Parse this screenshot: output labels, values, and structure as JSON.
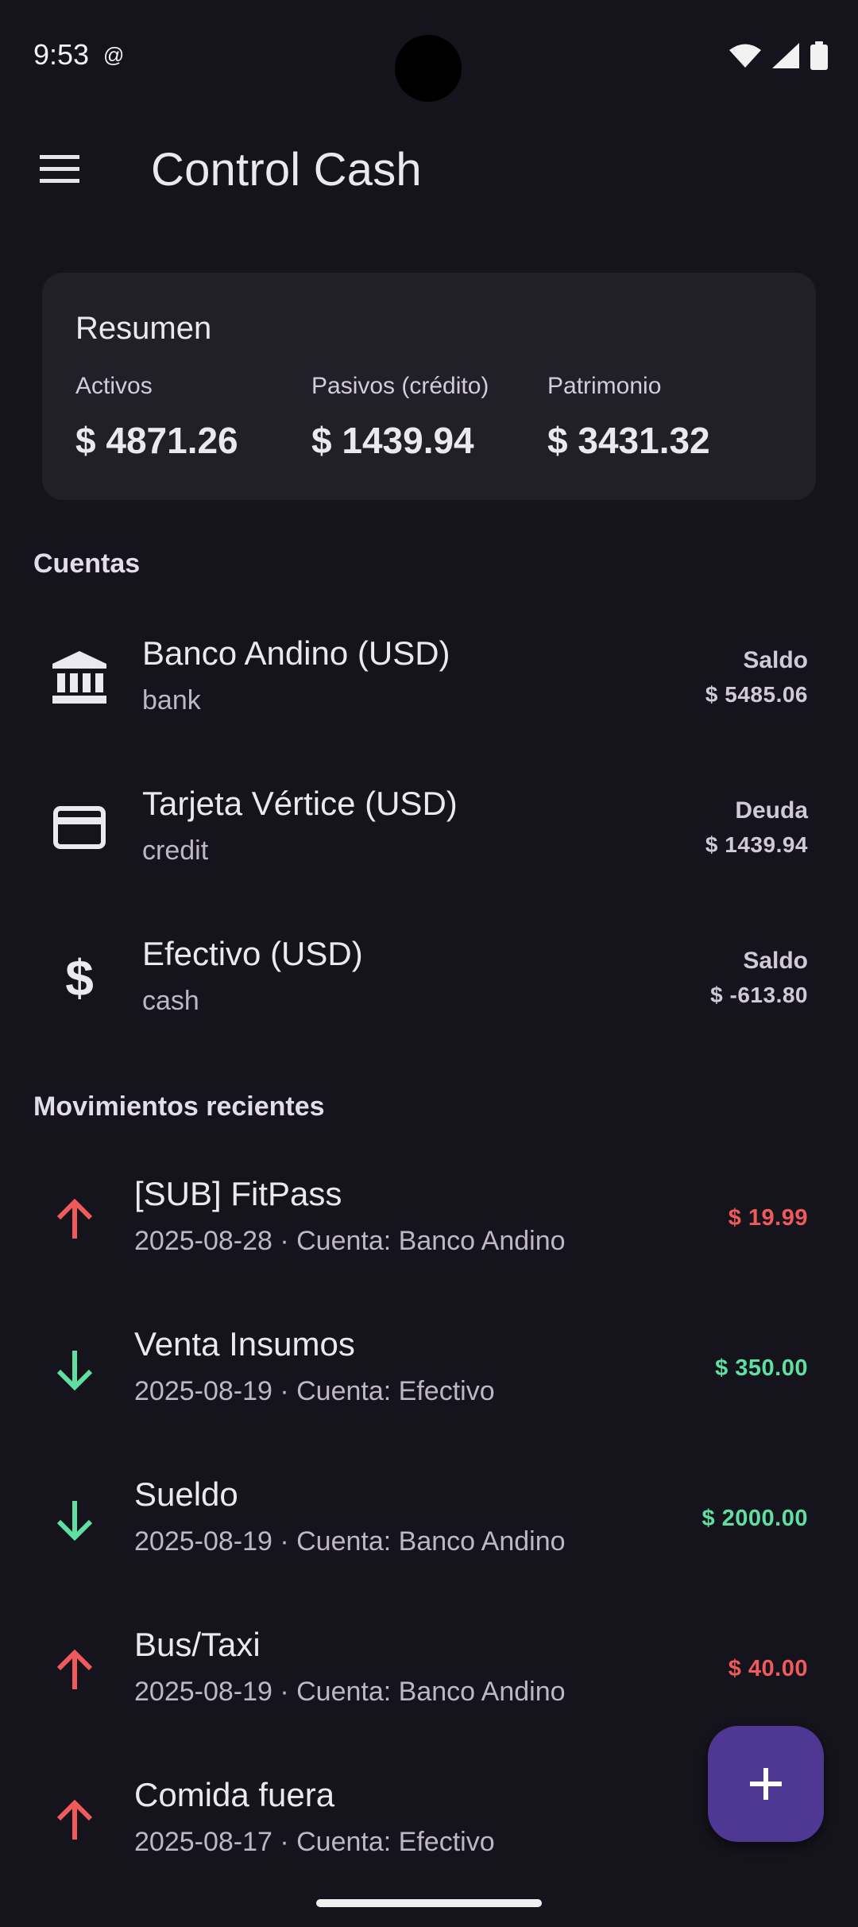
{
  "status_bar": {
    "time": "9:53",
    "notification_glyph": "@"
  },
  "app_bar": {
    "title": "Control Cash",
    "menu_icon": "menu-icon"
  },
  "summary": {
    "title": "Resumen",
    "items": [
      {
        "label": "Activos",
        "value": "$ 4871.26"
      },
      {
        "label": "Pasivos (crédito)",
        "value": "$ 1439.94"
      },
      {
        "label": "Patrimonio",
        "value": "$ 3431.32"
      }
    ]
  },
  "accounts": {
    "header": "Cuentas",
    "items": [
      {
        "name": "Banco Andino (USD)",
        "type": "bank",
        "kind": "Saldo",
        "balance": "$ 5485.06",
        "icon": "bank-icon"
      },
      {
        "name": "Tarjeta Vértice (USD)",
        "type": "credit",
        "kind": "Deuda",
        "balance": "$ 1439.94",
        "icon": "credit-card-icon"
      },
      {
        "name": "Efectivo (USD)",
        "type": "cash",
        "kind": "Saldo",
        "balance": "$ -613.80",
        "icon": "dollar-icon"
      }
    ]
  },
  "movements": {
    "header": "Movimientos recientes",
    "items": [
      {
        "title": "[SUB] FitPass",
        "subtitle": "2025-08-28 · Cuenta: Banco Andino",
        "amount": "$ 19.99",
        "direction": "out",
        "icon": "arrow-up-icon"
      },
      {
        "title": "Venta Insumos",
        "subtitle": "2025-08-19 · Cuenta: Efectivo",
        "amount": "$ 350.00",
        "direction": "in",
        "icon": "arrow-down-icon"
      },
      {
        "title": "Sueldo",
        "subtitle": "2025-08-19 · Cuenta: Banco Andino",
        "amount": "$ 2000.00",
        "direction": "in",
        "icon": "arrow-down-icon"
      },
      {
        "title": "Bus/Taxi",
        "subtitle": "2025-08-19 · Cuenta: Banco Andino",
        "amount": "$ 40.00",
        "direction": "out",
        "icon": "arrow-up-icon"
      },
      {
        "title": "Comida fuera",
        "subtitle": "2025-08-17 · Cuenta: Efectivo",
        "amount": "",
        "direction": "out",
        "icon": "arrow-up-icon"
      }
    ]
  },
  "fab": {
    "icon": "plus-icon"
  },
  "colors": {
    "background": "#15131b",
    "card": "#211f27",
    "expense": "#f05a5a",
    "income": "#5fe0a2",
    "fab": "#4f3894"
  }
}
